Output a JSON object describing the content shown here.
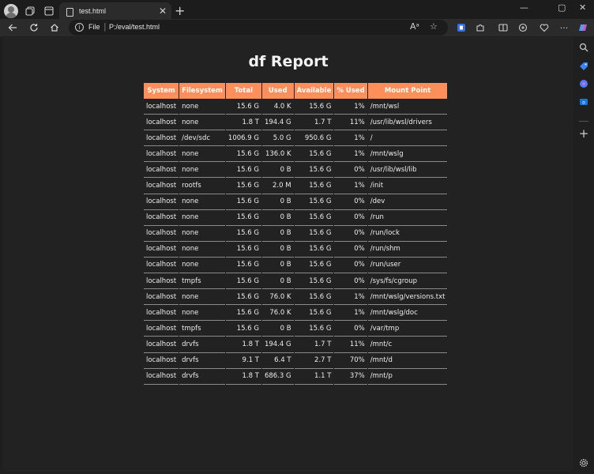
{
  "browser": {
    "tab_title": "test.html",
    "url_scheme": "File",
    "url_path": "P:/eval/test.html",
    "icons": {
      "profile": "avatar",
      "workspaces": "workspaces-icon",
      "tab_actions": "tab-actions-icon",
      "tab_page": "document-icon",
      "tab_close": "close-icon",
      "new_tab": "plus-icon",
      "minimize": "minimize-icon",
      "maximize": "maximize-icon",
      "close_window": "close-window-icon",
      "back": "back-arrow-icon",
      "refresh": "refresh-icon",
      "home": "home-icon",
      "site_info": "info-icon",
      "read_aloud": "read-aloud-icon",
      "favorite": "star-icon",
      "extensions": "puzzle-icon",
      "split": "split-screen-icon",
      "collections": "collections-icon",
      "copilot": "copilot-icon",
      "more": "more-icon",
      "sidebar_search": "search-icon",
      "sidebar_shopping": "tag-icon",
      "sidebar_apps": "apps-icon",
      "sidebar_outlook": "outlook-icon",
      "sidebar_add": "plus-icon",
      "sidebar_settings": "gear-icon"
    }
  },
  "page": {
    "title": "df Report",
    "columns": [
      "System",
      "Filesystem",
      "Total",
      "Used",
      "Available",
      "% Used",
      "Mount Point"
    ],
    "rows": [
      {
        "system": "localhost",
        "filesystem": "none",
        "total": "15.6 G",
        "used": "4.0 K",
        "available": "15.6 G",
        "pct": "1%",
        "mount": "/mnt/wsl",
        "warn": false
      },
      {
        "system": "localhost",
        "filesystem": "none",
        "total": "1.8 T",
        "used": "194.4 G",
        "available": "1.7 T",
        "pct": "11%",
        "mount": "/usr/lib/wsl/drivers",
        "warn": false
      },
      {
        "system": "localhost",
        "filesystem": "/dev/sdc",
        "total": "1006.9 G",
        "used": "5.0 G",
        "available": "950.6 G",
        "pct": "1%",
        "mount": "/",
        "warn": false
      },
      {
        "system": "localhost",
        "filesystem": "none",
        "total": "15.6 G",
        "used": "136.0 K",
        "available": "15.6 G",
        "pct": "1%",
        "mount": "/mnt/wslg",
        "warn": false
      },
      {
        "system": "localhost",
        "filesystem": "none",
        "total": "15.6 G",
        "used": "0 B",
        "available": "15.6 G",
        "pct": "0%",
        "mount": "/usr/lib/wsl/lib",
        "warn": false
      },
      {
        "system": "localhost",
        "filesystem": "rootfs",
        "total": "15.6 G",
        "used": "2.0 M",
        "available": "15.6 G",
        "pct": "1%",
        "mount": "/init",
        "warn": false
      },
      {
        "system": "localhost",
        "filesystem": "none",
        "total": "15.6 G",
        "used": "0 B",
        "available": "15.6 G",
        "pct": "0%",
        "mount": "/dev",
        "warn": false
      },
      {
        "system": "localhost",
        "filesystem": "none",
        "total": "15.6 G",
        "used": "0 B",
        "available": "15.6 G",
        "pct": "0%",
        "mount": "/run",
        "warn": false
      },
      {
        "system": "localhost",
        "filesystem": "none",
        "total": "15.6 G",
        "used": "0 B",
        "available": "15.6 G",
        "pct": "0%",
        "mount": "/run/lock",
        "warn": false
      },
      {
        "system": "localhost",
        "filesystem": "none",
        "total": "15.6 G",
        "used": "0 B",
        "available": "15.6 G",
        "pct": "0%",
        "mount": "/run/shm",
        "warn": false
      },
      {
        "system": "localhost",
        "filesystem": "none",
        "total": "15.6 G",
        "used": "0 B",
        "available": "15.6 G",
        "pct": "0%",
        "mount": "/run/user",
        "warn": false
      },
      {
        "system": "localhost",
        "filesystem": "tmpfs",
        "total": "15.6 G",
        "used": "0 B",
        "available": "15.6 G",
        "pct": "0%",
        "mount": "/sys/fs/cgroup",
        "warn": false
      },
      {
        "system": "localhost",
        "filesystem": "none",
        "total": "15.6 G",
        "used": "76.0 K",
        "available": "15.6 G",
        "pct": "1%",
        "mount": "/mnt/wslg/versions.txt",
        "warn": false
      },
      {
        "system": "localhost",
        "filesystem": "none",
        "total": "15.6 G",
        "used": "76.0 K",
        "available": "15.6 G",
        "pct": "1%",
        "mount": "/mnt/wslg/doc",
        "warn": false
      },
      {
        "system": "localhost",
        "filesystem": "tmpfs",
        "total": "15.6 G",
        "used": "0 B",
        "available": "15.6 G",
        "pct": "0%",
        "mount": "/var/tmp",
        "warn": false
      },
      {
        "system": "localhost",
        "filesystem": "drvfs",
        "total": "1.8 T",
        "used": "194.4 G",
        "available": "1.7 T",
        "pct": "11%",
        "mount": "/mnt/c",
        "warn": false
      },
      {
        "system": "localhost",
        "filesystem": "drvfs",
        "total": "9.1 T",
        "used": "6.4 T",
        "available": "2.7 T",
        "pct": "70%",
        "mount": "/mnt/d",
        "warn": true
      },
      {
        "system": "localhost",
        "filesystem": "drvfs",
        "total": "1.8 T",
        "used": "686.3 G",
        "available": "1.1 T",
        "pct": "37%",
        "mount": "/mnt/p",
        "warn": false
      }
    ]
  },
  "colors": {
    "header_bg": "#ff8f5a",
    "warn_text": "#e6d21a",
    "page_bg": "#222222"
  }
}
